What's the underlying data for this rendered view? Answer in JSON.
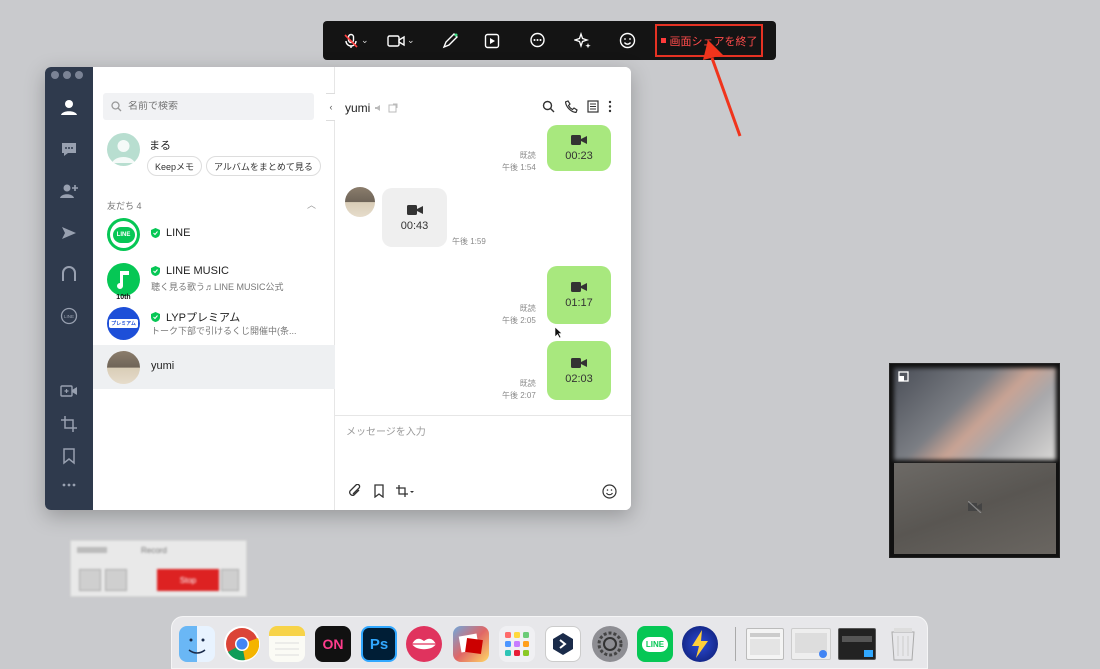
{
  "toolbar": {
    "end_share_label": "画面シェアを終了",
    "items": [
      "mic-muted-icon",
      "video-camera-icon",
      "pen-icon",
      "share-screen-icon",
      "chat-bubble-icon",
      "sparkle-effects-icon",
      "emoji-icon"
    ]
  },
  "line": {
    "search_placeholder": "名前で検索",
    "collapse": "‹",
    "my_profile": {
      "name": "まる",
      "pill_keep": "Keepメモ",
      "pill_album": "アルバムをまとめて見る"
    },
    "friends_header": "友だち 4",
    "friends_caret": "︿",
    "friends": [
      {
        "name": "LINE",
        "sub": "",
        "avatar_color": "#06c755",
        "avatar_text": "LINE"
      },
      {
        "name": "LINE MUSIC",
        "sub": "聴く見る歌う♬LINE MUSIC公式",
        "avatar_color": "#06c755",
        "avatar_text": "10th"
      },
      {
        "name": "LYPプレミアム",
        "sub": "トーク下部で引けるくじ開催中(条...",
        "avatar_color": "#1d4fd8",
        "avatar_text": "プレミアム"
      },
      {
        "name": "yumi",
        "sub": "",
        "avatar_color": "#9c8f7e",
        "avatar_text": ""
      }
    ],
    "chat": {
      "title": "yumi",
      "messages": [
        {
          "dir": "out",
          "duration": "00:23",
          "read": "既読",
          "time": "午後 1:54"
        },
        {
          "dir": "in",
          "duration": "00:43",
          "time": "午後 1:59"
        },
        {
          "dir": "out",
          "duration": "01:17",
          "read": "既読",
          "time": "午後 2:05"
        },
        {
          "dir": "out",
          "duration": "02:03",
          "read": "既読",
          "time": "午後 2:07"
        }
      ],
      "input_placeholder": "メッセージを入力"
    }
  },
  "recorder": {
    "title": "Record",
    "stop_label": "Stop"
  },
  "dock": {
    "apps": [
      "Finder",
      "Chrome",
      "Notes",
      "ON",
      "Photoshop",
      "Kiss",
      "Photo Booth",
      "Launchpad",
      "Remote",
      "System Settings",
      "LINE",
      "Reeder"
    ],
    "labels": {
      "on": "ON",
      "ps": "Ps",
      "line": "LINE"
    }
  },
  "colors": {
    "accent_red": "#e63223",
    "line_green": "#06c755",
    "bubble_green": "#a8e87e",
    "rail": "#2f3a4d"
  }
}
